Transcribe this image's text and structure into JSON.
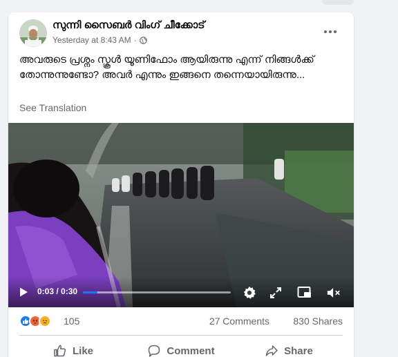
{
  "post": {
    "page_name": "സുന്നി സൈബർ വിംഗ് ചീക്കോട്",
    "timestamp": "Yesterday at 8:43 AM",
    "separator": "·",
    "privacy_icon": "globe-icon",
    "more_icon": "more-options-icon",
    "text": "അവരുടെ പ്രശ്നം സ്കൂൾ യൂണിഫോം ആയിരുന്നു എന്ന് നിങ്ങൾക്ക് തോന്നുന്നുണ്ടോ? അവർ എന്നും ഇങ്ങനെ തന്നെയായിരുന്നു...",
    "see_translation": "See Translation"
  },
  "video": {
    "current_time": "0:03",
    "duration": "0:30",
    "time_display": "0:03 / 0:30",
    "progress_fraction": 0.1,
    "accent": "#1877f2",
    "icons": [
      "play-icon",
      "settings-icon",
      "fullscreen-icon",
      "picture-in-picture-icon",
      "muted-icon"
    ]
  },
  "stats": {
    "reactions": [
      "like",
      "angry",
      "sad"
    ],
    "reaction_count": "105",
    "comments": "27 Comments",
    "shares": "830 Shares"
  },
  "actions": {
    "like_label": "Like",
    "comment_label": "Comment",
    "share_label": "Share"
  },
  "colors": {
    "background": "#f0f2f5",
    "card": "#ffffff",
    "secondary_text": "#65676b",
    "like_blue": "#1877f2",
    "angry_orange": "#f0663b",
    "sad_yellow": "#f7b125"
  }
}
